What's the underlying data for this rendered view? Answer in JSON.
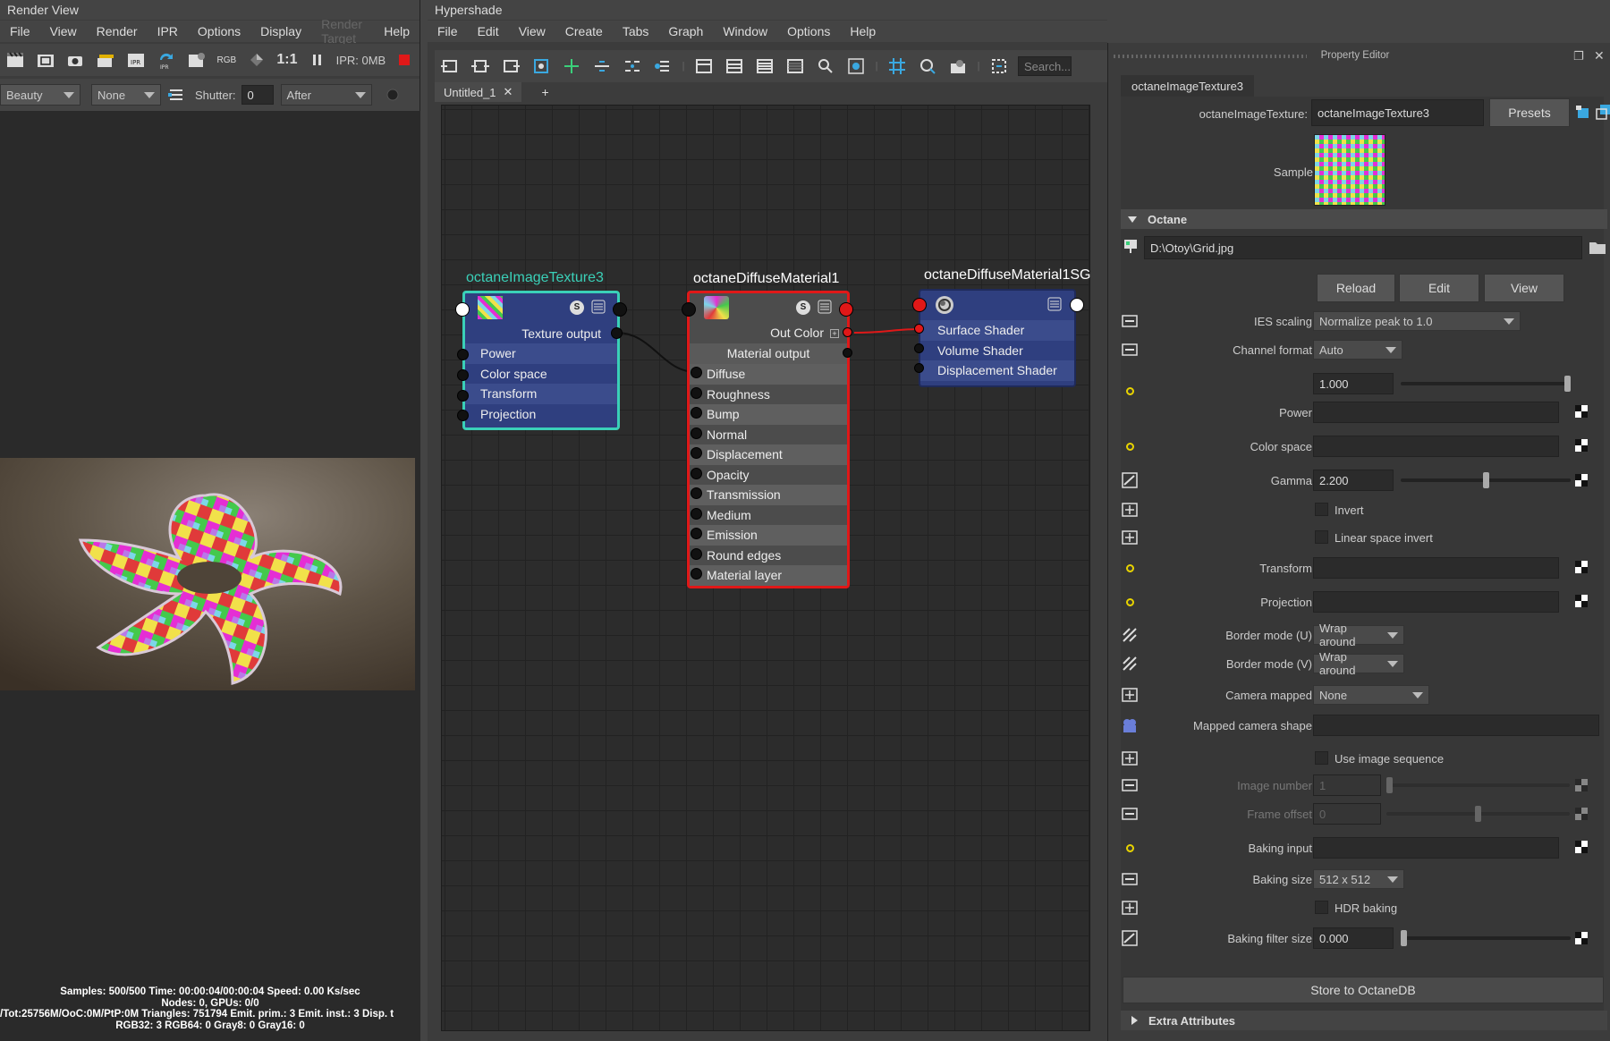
{
  "render_view": {
    "title": "Render View",
    "menu": [
      "File",
      "View",
      "Render",
      "IPR",
      "Options",
      "Display",
      "Render Target",
      "Help"
    ],
    "toolbar": {
      "rgb_label": "RGB",
      "ratio_label": "1:1",
      "ipr_label": "IPR: 0MB"
    },
    "controls": {
      "pass": "Beauty",
      "layer": "None",
      "shutter_label": "Shutter:",
      "shutter_value": "0",
      "mode": "After"
    },
    "status": [
      "Samples: 500/500 Time: 00:00:04/00:00:04 Speed: 0.00 Ks/sec",
      "Nodes: 0, GPUs: 0/0",
      "/Tot:25756M/OoC:0M/PtP:0M Triangles: 751794 Emit. prim.: 3 Emit. inst.: 3 Disp. t",
      "RGB32: 3 RGB64: 0 Gray8: 0 Gray16: 0"
    ]
  },
  "hypershade": {
    "title": "Hypershade",
    "menu": [
      "File",
      "Edit",
      "View",
      "Create",
      "Tabs",
      "Graph",
      "Window",
      "Options",
      "Help"
    ],
    "search_placeholder": "Search...",
    "tabs": [
      {
        "label": "Untitled_1"
      }
    ],
    "add_tab": "+",
    "nodes": {
      "texture": {
        "title": "octaneImageTexture3",
        "output": "Texture output",
        "inputs": [
          "Power",
          "Color space",
          "Transform",
          "Projection"
        ]
      },
      "diffuse": {
        "title": "octaneDiffuseMaterial1",
        "out_color": "Out Color",
        "output": "Material output",
        "inputs": [
          "Diffuse",
          "Roughness",
          "Bump",
          "Normal",
          "Displacement",
          "Opacity",
          "Transmission",
          "Medium",
          "Emission",
          "Round edges",
          "Material layer"
        ]
      },
      "sg": {
        "title": "octaneDiffuseMaterial1SG",
        "inputs": [
          "Surface Shader",
          "Volume Shader",
          "Displacement Shader"
        ]
      }
    }
  },
  "property_editor": {
    "title": "Property Editor",
    "tab": "octaneImageTexture3",
    "type_label": "octaneImageTexture:",
    "node_name": "octaneImageTexture3",
    "presets": "Presets",
    "sample_label": "Sample",
    "section": "Octane",
    "file_path": "D:\\Otoy\\Grid.jpg",
    "buttons": {
      "reload": "Reload",
      "edit": "Edit",
      "view": "View"
    },
    "ies_label": "IES scaling",
    "ies_value": "Normalize peak to 1.0",
    "channel_label": "Channel format",
    "channel_value": "Auto",
    "power_value": "1.000",
    "power_level": 1.0,
    "power_label": "Power",
    "colorspace_label": "Color space",
    "gamma_label": "Gamma",
    "gamma_value": "2.200",
    "gamma_level": 0.5,
    "invert_label": "Invert",
    "linear_invert_label": "Linear space invert",
    "transform_label": "Transform",
    "projection_label": "Projection",
    "border_u_label": "Border mode (U)",
    "border_u_value": "Wrap around",
    "border_v_label": "Border mode (V)",
    "border_v_value": "Wrap around",
    "camera_mapped_label": "Camera mapped",
    "camera_mapped_value": "None",
    "mapped_shape_label": "Mapped camera shape",
    "use_seq_label": "Use image sequence",
    "image_number_label": "Image number",
    "image_number_value": "1",
    "frame_offset_label": "Frame offset",
    "frame_offset_value": "0",
    "baking_input_label": "Baking input",
    "baking_size_label": "Baking size",
    "baking_size_value": "512 x 512",
    "hdr_baking_label": "HDR baking",
    "baking_filter_label": "Baking filter size",
    "baking_filter_value": "0.000",
    "store": "Store to OctaneDB",
    "extra": "Extra Attributes"
  },
  "colors": {
    "texture_border": "#3ad0b8",
    "selected_border": "#e01818",
    "node_fill": "#2f3f7f",
    "node_row": "#3b4c8c",
    "diffuse_fill": "#5a5a5a"
  }
}
